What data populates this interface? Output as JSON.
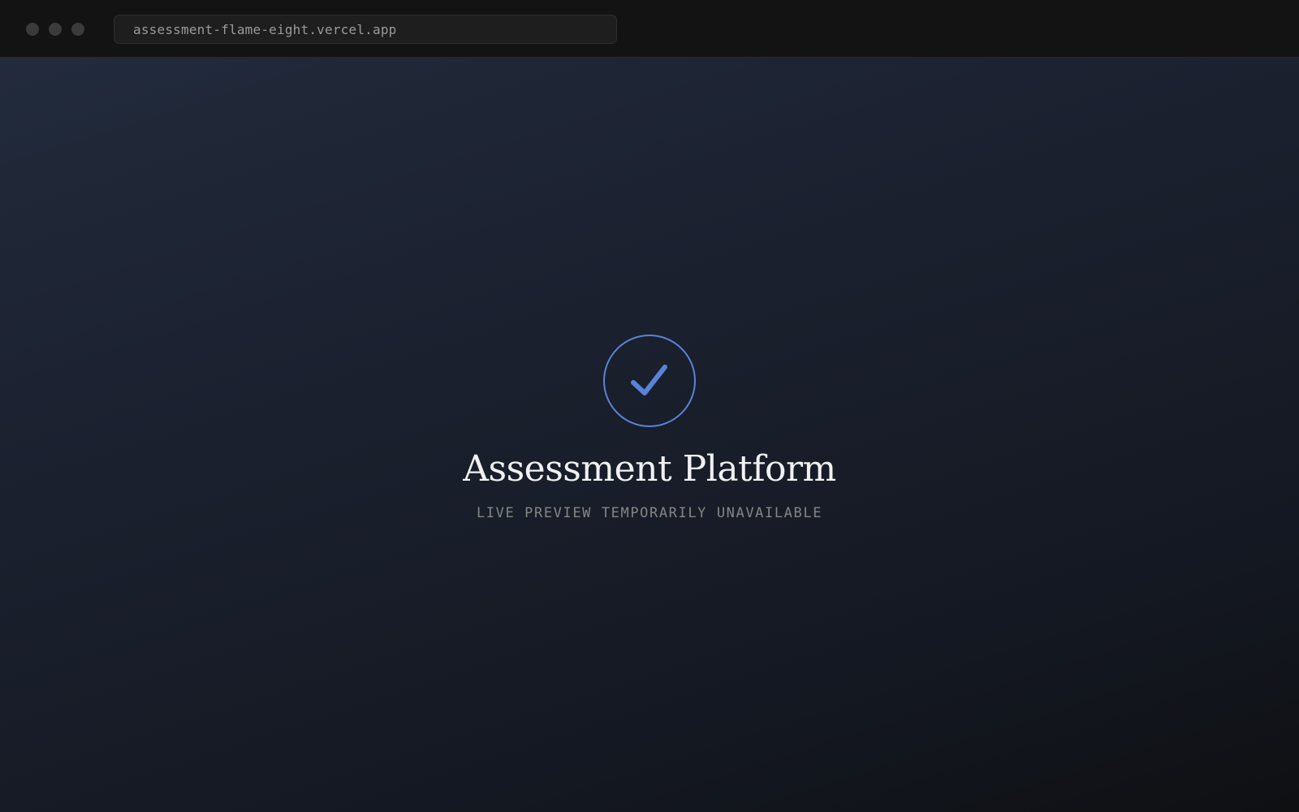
{
  "browser": {
    "url": "assessment-flame-eight.vercel.app"
  },
  "main": {
    "icon": "checkmark-circle-icon",
    "title": "Assessment Platform",
    "subtitle": "LIVE PREVIEW TEMPORARILY UNAVAILABLE"
  },
  "colors": {
    "accent": "#5a82d8",
    "chrome_background": "#131313",
    "page_background_top": "#222b3c",
    "page_background_bottom": "#0f1012",
    "title_text": "#f1f1f1",
    "subtitle_text": "#858585"
  }
}
